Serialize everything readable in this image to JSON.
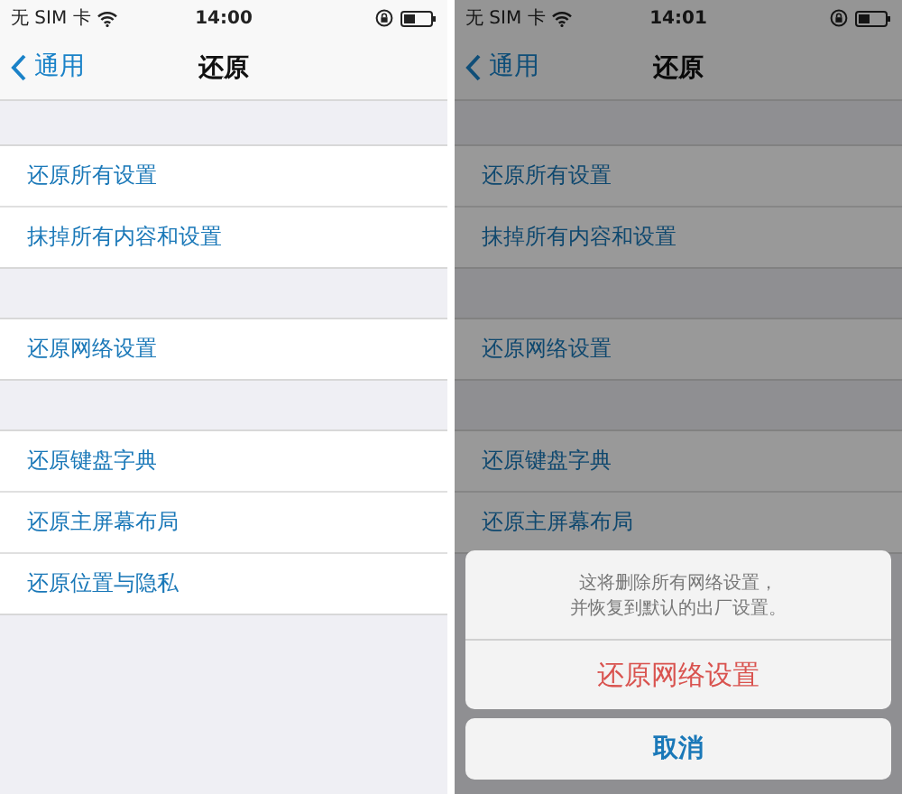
{
  "screens": [
    {
      "dimmed": false,
      "status_bar": {
        "carrier": "无 SIM 卡",
        "time": "14:00"
      },
      "nav": {
        "back": "通用",
        "title": "还原"
      },
      "groups": [
        [
          "还原所有设置",
          "抹掉所有内容和设置"
        ],
        [
          "还原网络设置"
        ],
        [
          "还原键盘字典",
          "还原主屏幕布局",
          "还原位置与隐私"
        ]
      ]
    },
    {
      "dimmed": true,
      "status_bar": {
        "carrier": "无 SIM 卡",
        "time": "14:01"
      },
      "nav": {
        "back": "通用",
        "title": "还原"
      },
      "groups": [
        [
          "还原所有设置",
          "抹掉所有内容和设置"
        ],
        [
          "还原网络设置"
        ],
        [
          "还原键盘字典",
          "还原主屏幕布局"
        ]
      ],
      "action_sheet": {
        "message_lines": [
          "这将删除所有网络设置，",
          "并恢复到默认的出厂设置。"
        ],
        "destructive_button": "还原网络设置",
        "cancel_button": "取消"
      }
    }
  ]
}
